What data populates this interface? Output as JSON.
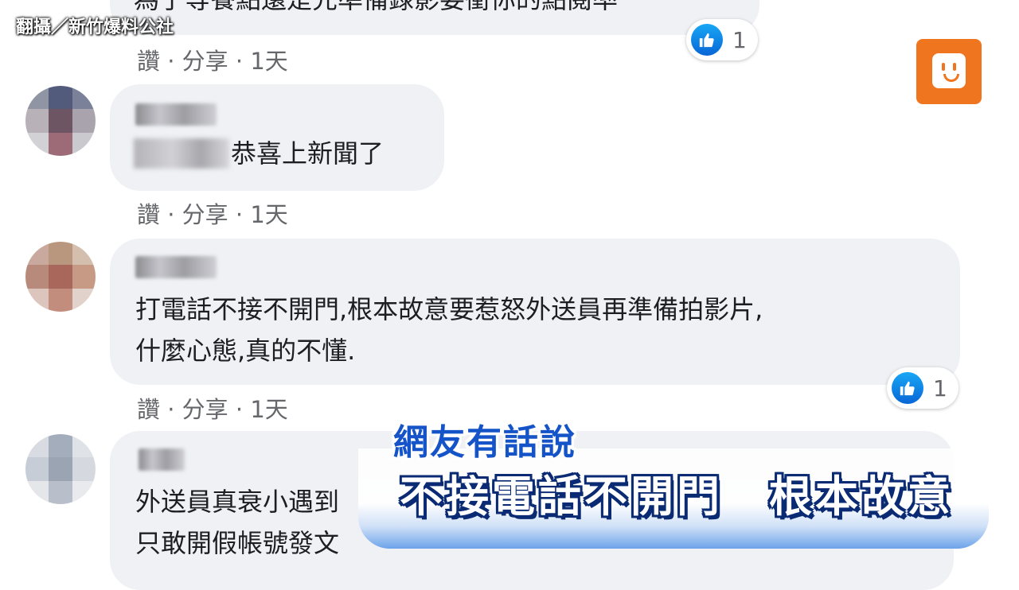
{
  "watermark": {
    "credit": "翻攝／新竹爆料公社"
  },
  "comments": [
    {
      "partial_text": "為了等餐點還是先準備錄影要衝你的點閱率",
      "actions": {
        "like": "讚",
        "sep1": " · ",
        "share": "分享",
        "sep2": " · ",
        "time": "1天"
      },
      "reaction_count": "1"
    },
    {
      "text_lines": [
        "恭喜上新聞了"
      ],
      "actions": {
        "like": "讚",
        "sep1": " · ",
        "share": "分享",
        "sep2": " · ",
        "time": "1天"
      }
    },
    {
      "text_lines": [
        "打電話不接不開門,根本故意要惹怒外送員再準備拍影片,",
        "什麼心態,真的不懂."
      ],
      "actions": {
        "like": "讚",
        "sep1": " · ",
        "share": "分享",
        "sep2": " · ",
        "time": "1天"
      },
      "reaction_count": "1"
    },
    {
      "text_lines": [
        "外送員真衰小遇到",
        "只敢開假帳號發文"
      ]
    }
  ],
  "caption": {
    "title": "網友有話說",
    "main": "不接電話不開門　根本故意"
  },
  "colors": {
    "bubble": "#eff1f4",
    "like_blue": "#0866d6",
    "logo_orange": "#f0751f",
    "caption_blue": "#1454c8"
  }
}
